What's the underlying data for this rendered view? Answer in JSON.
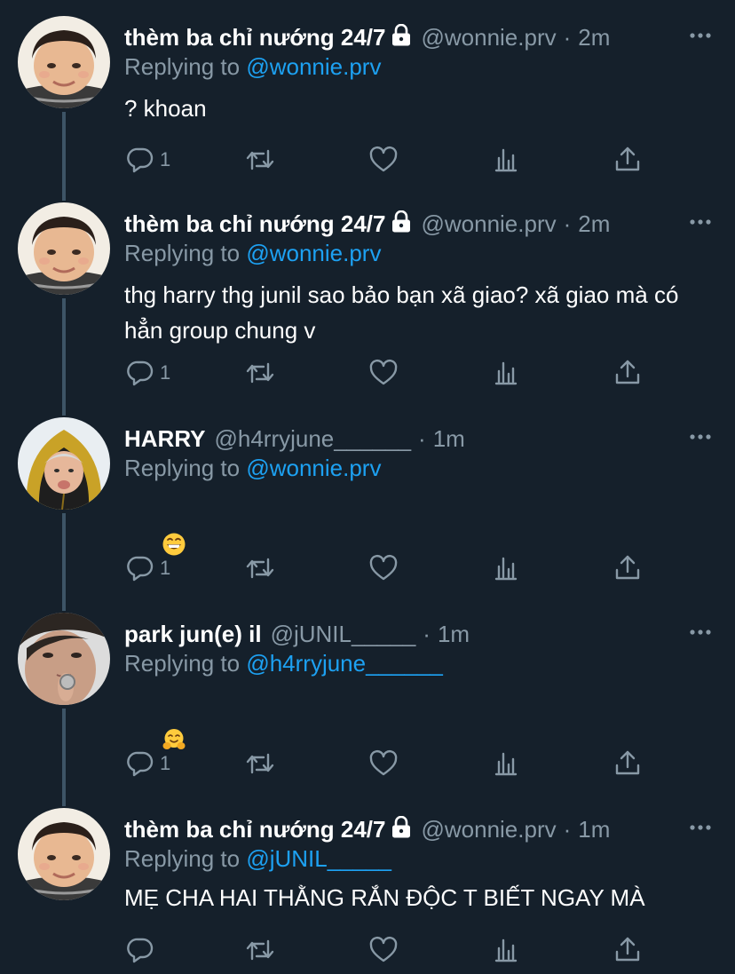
{
  "colors": {
    "background": "#15202b",
    "text_primary": "#ffffff",
    "text_secondary": "#8899a6",
    "link": "#1da1f2",
    "thread_line": "#3d5466"
  },
  "reply_prefix": "Replying to",
  "tweets": [
    {
      "name": "thèm ba chỉ nướng 24/7",
      "protected": true,
      "handle": "@wonnie.prv",
      "separator": "·",
      "time": "2m",
      "reply_to": "@wonnie.prv",
      "text": "? khoan",
      "reply_count": "1",
      "avatar": "toddler-avatar"
    },
    {
      "name": "thèm ba chỉ nướng 24/7",
      "protected": true,
      "handle": "@wonnie.prv",
      "separator": "·",
      "time": "2m",
      "reply_to": "@wonnie.prv",
      "text": "thg harry thg junil sao bảo bạn xã giao? xã giao mà có hẳn group chung v",
      "reply_count": "1",
      "avatar": "toddler-avatar"
    },
    {
      "name": "HARRY",
      "protected": false,
      "handle": "@h4rryjune______",
      "separator": "·",
      "time": "1m",
      "reply_to": "@wonnie.prv",
      "emoji": "grinning-face-emoji",
      "reply_count": "1",
      "avatar": "yellow-hood-avatar"
    },
    {
      "name": "park jun(e) il",
      "protected": false,
      "handle": "@jUNIL_____",
      "separator": "·",
      "time": "1m",
      "reply_to": "@h4rryjune______",
      "emoji": "hugging-face-emoji",
      "reply_count": "1",
      "avatar": "selfie-avatar"
    },
    {
      "name": "thèm ba chỉ nướng 24/7",
      "protected": true,
      "handle": "@wonnie.prv",
      "separator": "·",
      "time": "1m",
      "reply_to": "@jUNIL_____",
      "text": "MẸ CHA HAI THẰNG RẮN ĐỘC T BIẾT NGAY MÀ",
      "reply_count": "",
      "avatar": "toddler-avatar"
    }
  ],
  "action_icons": [
    "reply-icon",
    "retweet-icon",
    "like-icon",
    "analytics-icon",
    "share-icon"
  ]
}
